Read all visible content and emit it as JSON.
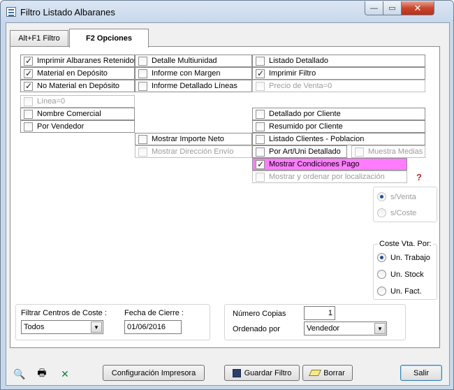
{
  "window": {
    "title": "Filtro Listado Albaranes",
    "controls": {
      "minimize": "—",
      "maximize": "▭",
      "close": "✕"
    }
  },
  "tabs": [
    {
      "label": "Alt+F1 Filtro",
      "active": false
    },
    {
      "label": "F2 Opciones",
      "active": true
    }
  ],
  "checks": {
    "imprimir_albaranes_retenidos": {
      "label": "Imprimir Albaranes Retenidos",
      "checked": true
    },
    "material_deposito": {
      "label": "Material en Depósito",
      "checked": true
    },
    "no_material_deposito": {
      "label": "No Material en Depósito",
      "checked": true
    },
    "linea_cero": {
      "label": "Línea=0",
      "checked": false,
      "disabled": true
    },
    "nombre_comercial": {
      "label": "Nombre Comercial",
      "checked": false
    },
    "por_vendedor": {
      "label": "Por Vendedor",
      "checked": false
    },
    "detalle_multiunidad": {
      "label": "Detalle Multiunidad",
      "checked": false
    },
    "informe_margen": {
      "label": "Informe con Margen",
      "checked": false
    },
    "informe_detallado_lineas": {
      "label": "Informe Detallado Líneas",
      "checked": false
    },
    "mostrar_importe_neto": {
      "label": "Mostrar Importe Neto",
      "checked": false
    },
    "mostrar_direccion_envio": {
      "label": "Mostrar Dirección Envío",
      "checked": false,
      "disabled": true
    },
    "listado_detallado": {
      "label": "Listado Detallado",
      "checked": false
    },
    "imprimir_filtro": {
      "label": "Imprimir Filtro",
      "checked": true
    },
    "precio_venta_cero": {
      "label": "Precio de Venta=0",
      "checked": false,
      "disabled": true
    },
    "detallado_cliente": {
      "label": "Detallado por Cliente",
      "checked": false
    },
    "resumido_cliente": {
      "label": "Resumido por Cliente",
      "checked": false
    },
    "listado_clientes_poblacion": {
      "label": "Listado Clientes - Poblacion",
      "checked": false
    },
    "por_art_uni_detallado": {
      "label": "Por Art/Uni Detallado",
      "checked": false
    },
    "muestra_medias": {
      "label": "Muestra Medias",
      "checked": false,
      "disabled": true
    },
    "mostrar_condiciones_pago": {
      "label": "Mostrar Condiciones Pago",
      "checked": true,
      "highlight": "#ff7cff"
    },
    "mostrar_ordenar_localizacion": {
      "label": "Mostrar y ordenar por localización",
      "checked": false,
      "disabled": true
    }
  },
  "radio_venta": {
    "options": [
      {
        "label": "s/Venta",
        "selected": true,
        "disabled": true
      },
      {
        "label": "s/Coste",
        "selected": false,
        "disabled": true
      }
    ]
  },
  "coste_vta": {
    "title": "Coste Vta. Por:",
    "options": [
      {
        "label": "Un. Trabajo",
        "selected": true
      },
      {
        "label": "Un. Stock",
        "selected": false
      },
      {
        "label": "Un. Fact.",
        "selected": false
      }
    ]
  },
  "filtros": {
    "centros_coste_label": "Filtrar Centros de Coste :",
    "centros_coste_value": "Todos",
    "fecha_cierre_label": "Fecha de Cierre :",
    "fecha_cierre_value": "01/06/2016"
  },
  "copias": {
    "numero_copias_label": "Número Copias",
    "numero_copias_value": "1",
    "ordenado_por_label": "Ordenado por",
    "ordenado_por_value": "Vendedor"
  },
  "footer": {
    "configuracion_impresora": "Configuración Impresora",
    "guardar_filtro": "Guardar Filtro",
    "borrar": "Borrar",
    "salir": "Salir"
  },
  "icons": {
    "help": "?",
    "preview": "🔍",
    "print": "🖶",
    "excel": "✕"
  },
  "colors": {
    "highlight": "#ff7cff",
    "help_icon": "#c0282b"
  }
}
